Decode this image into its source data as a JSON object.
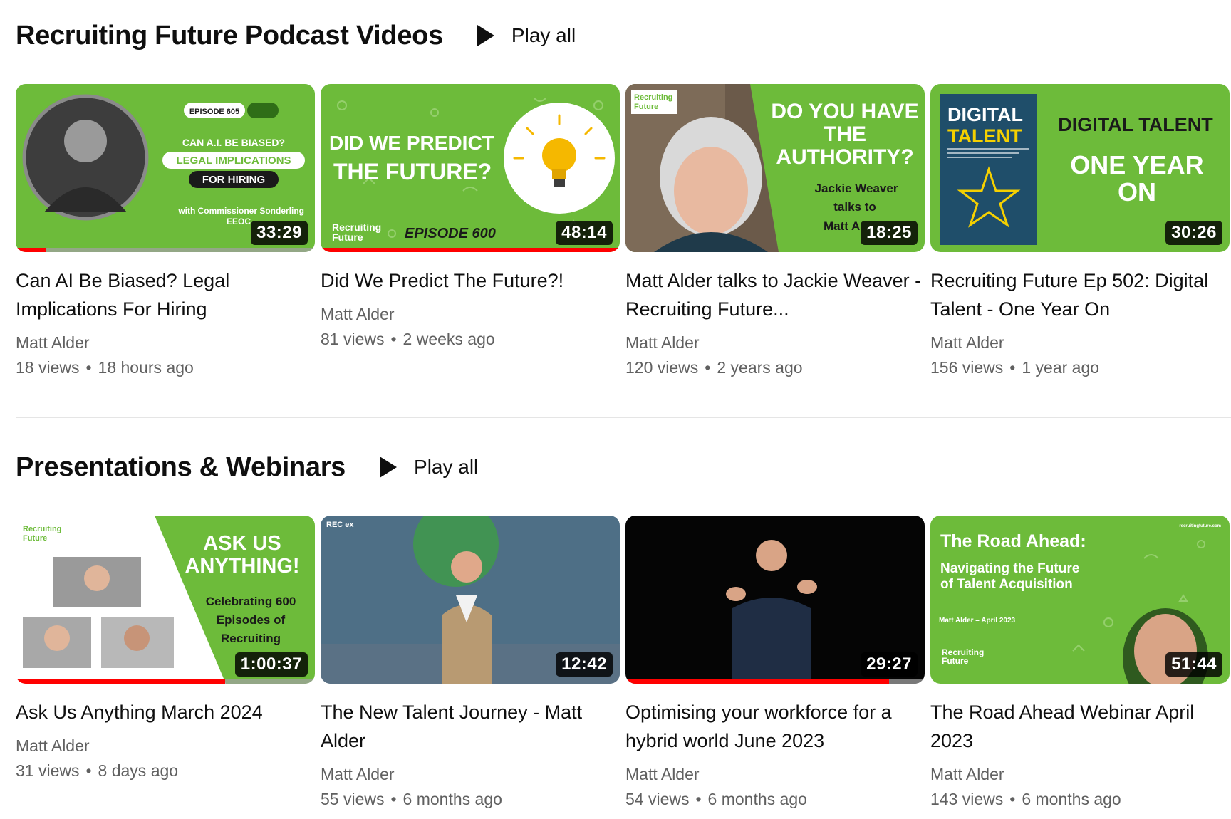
{
  "colors": {
    "accent_green": "#6dbb3a",
    "progress_red": "#ff0000",
    "text_primary": "#0f0f0f",
    "text_secondary": "#606060"
  },
  "icons": {
    "play_all": "play-triangle-icon"
  },
  "shelves": [
    {
      "title": "Recruiting Future Podcast Videos",
      "play_all_label": "Play all",
      "videos": [
        {
          "title": "Can AI Be Biased? Legal Implications For Hiring",
          "channel": "Matt Alder",
          "views": "18 views",
          "age": "18 hours ago",
          "duration": "33:29",
          "watched": 0.1,
          "thumb": {
            "badge": "EPISODE 605",
            "line1": "CAN A.I. BE BIASED?",
            "line2": "LEGAL IMPLICATIONS",
            "line3": "FOR HIRING",
            "line4": "with Commissioner Sonderling",
            "line5": "EEOC"
          }
        },
        {
          "title": "Did We Predict The Future?!",
          "channel": "Matt Alder",
          "views": "81 views",
          "age": "2 weeks ago",
          "duration": "48:14",
          "watched": 1.0,
          "thumb": {
            "line1": "DID WE PREDICT",
            "line2": "THE FUTURE?",
            "brand1": "Recruiting",
            "brand2": "Future",
            "episode": "EPISODE 600"
          }
        },
        {
          "title": "Matt Alder talks to Jackie Weaver - Recruiting Future...",
          "channel": "Matt Alder",
          "views": "120 views",
          "age": "2 years ago",
          "duration": "18:25",
          "watched": 0,
          "thumb": {
            "brand1": "Recruiting",
            "brand2": "Future",
            "line1": "DO YOU HAVE",
            "line2": "THE",
            "line3": "AUTHORITY?",
            "line4": "Jackie Weaver",
            "line5": "talks to",
            "line6": "Matt A"
          }
        },
        {
          "title": "Recruiting Future Ep 502: Digital Talent - One Year On",
          "channel": "Matt Alder",
          "views": "156 views",
          "age": "1 year ago",
          "duration": "30:26",
          "watched": 0,
          "thumb": {
            "book1": "DIGITAL",
            "book2": "TALENT",
            "line1": "DIGITAL TALENT",
            "line2": "ONE YEAR",
            "line3": "ON"
          }
        }
      ]
    },
    {
      "title": "Presentations & Webinars",
      "play_all_label": "Play all",
      "videos": [
        {
          "title": "Ask Us Anything March 2024",
          "channel": "Matt Alder",
          "views": "31 views",
          "age": "8 days ago",
          "duration": "1:00:37",
          "watched": 0.7,
          "thumb": {
            "brand1": "Recruiting",
            "brand2": "Future",
            "line1": "ASK US",
            "line2": "ANYTHING!",
            "line3": "Celebrating 600",
            "line4": "Episodes of",
            "line5": "Recruiting"
          }
        },
        {
          "title": "The New Talent Journey - Matt Alder",
          "channel": "Matt Alder",
          "views": "55 views",
          "age": "6 months ago",
          "duration": "12:42",
          "watched": 0,
          "thumb": {
            "corner": "REC ex"
          }
        },
        {
          "title": "Optimising your workforce for a hybrid world June 2023",
          "channel": "Matt Alder",
          "views": "54 views",
          "age": "6 months ago",
          "duration": "29:27",
          "watched": 0.88,
          "thumb": {}
        },
        {
          "title": "The Road Ahead Webinar April 2023",
          "channel": "Matt Alder",
          "views": "143 views",
          "age": "6 months ago",
          "duration": "51:44",
          "watched": 0,
          "thumb": {
            "line1": "The Road Ahead:",
            "line2": "Navigating the Future",
            "line3": "of Talent Acquisition",
            "line4": "Matt Alder – April 2023",
            "brand1": "Recruiting",
            "brand2": "Future",
            "site": "recruitingfuture.com"
          }
        }
      ]
    }
  ]
}
